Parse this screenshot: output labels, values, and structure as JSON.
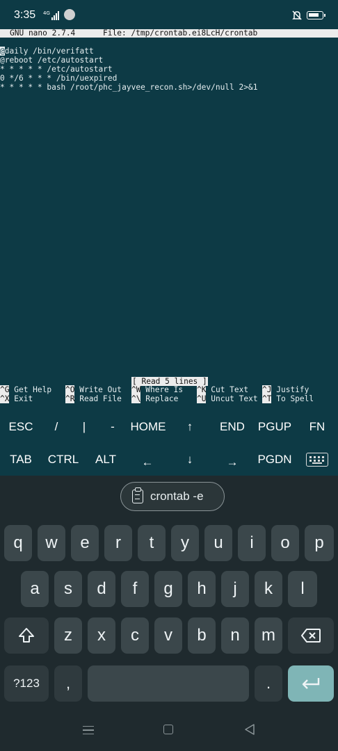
{
  "statusbar": {
    "time": "3:35",
    "network": "4G",
    "battery_level": 0.75
  },
  "nano": {
    "version": "GNU nano 2.7.4",
    "file": "File: /tmp/crontab.ei8LcH/crontab",
    "lines": [
      "@daily /bin/verifatt",
      "@reboot /etc/autostart",
      "* * * * * /etc/autostart",
      "0 */6 * * * /bin/uexpired",
      "* * * * * bash /root/phc_jayvee_recon.sh>/dev/null 2>&1"
    ],
    "status_message": "[ Read 5 lines ]",
    "shortcuts": [
      {
        "key": "^G",
        "label": "Get Help"
      },
      {
        "key": "^O",
        "label": "Write Out"
      },
      {
        "key": "^W",
        "label": "Where Is"
      },
      {
        "key": "^K",
        "label": "Cut Text"
      },
      {
        "key": "^J",
        "label": "Justify"
      },
      {
        "key": "^X",
        "label": "Exit"
      },
      {
        "key": "^R",
        "label": "Read File"
      },
      {
        "key": "^\\",
        "label": "Replace"
      },
      {
        "key": "^U",
        "label": "Uncut Text"
      },
      {
        "key": "^T",
        "label": "To Spell"
      }
    ]
  },
  "extra_keys": {
    "row1": [
      "ESC",
      "/",
      "|",
      "-",
      "HOME",
      "↑",
      "END",
      "PGUP",
      "FN"
    ],
    "row2": [
      "TAB",
      "CTRL",
      "ALT",
      "←",
      "↓",
      "→",
      "PGDN"
    ]
  },
  "keyboard": {
    "suggestion": "crontab -e",
    "row1": [
      "q",
      "w",
      "e",
      "r",
      "t",
      "y",
      "u",
      "i",
      "o",
      "p"
    ],
    "row2": [
      "a",
      "s",
      "d",
      "f",
      "g",
      "h",
      "j",
      "k",
      "l"
    ],
    "row3": [
      "z",
      "x",
      "c",
      "v",
      "b",
      "n",
      "m"
    ],
    "symbols_label": "?123",
    "comma": ",",
    "period": "."
  },
  "colors": {
    "terminal_bg": "#0d3a45",
    "keyboard_bg": "#1f2a2e",
    "key_bg": "#3b474b",
    "enter_key": "#7fb5b6"
  }
}
